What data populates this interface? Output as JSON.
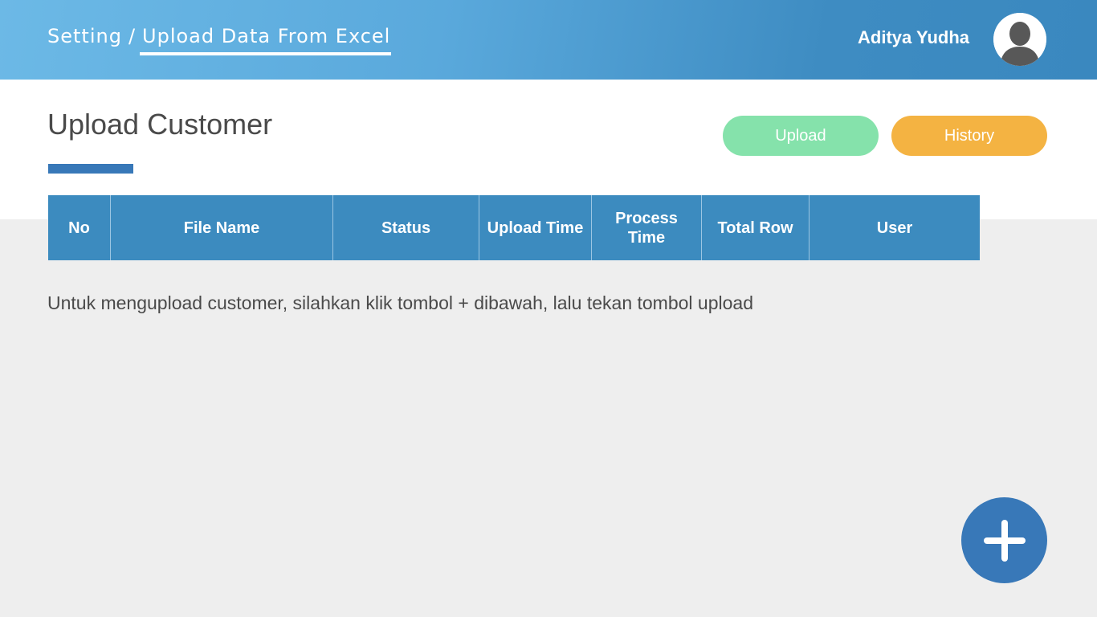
{
  "header": {
    "breadcrumb": {
      "parent": "Setting",
      "separator": "/",
      "current": "Upload Data From Excel"
    },
    "user": {
      "name": "Aditya Yudha",
      "avatar_icon": "user-avatar-icon"
    }
  },
  "main": {
    "title": "Upload Customer",
    "buttons": {
      "upload_label": "Upload",
      "history_label": "History"
    },
    "table": {
      "columns": [
        {
          "label": "No"
        },
        {
          "label": "File Name"
        },
        {
          "label": "Status"
        },
        {
          "label": "Upload Time"
        },
        {
          "label": "Process Time"
        },
        {
          "label": "Total Row"
        },
        {
          "label": "User"
        }
      ],
      "rows": []
    },
    "hint": "Untuk mengupload customer, silahkan klik tombol + dibawah, lalu tekan tombol upload",
    "fab_icon": "plus-icon"
  },
  "colors": {
    "header_gradient_start": "#6cb9e6",
    "header_gradient_end": "#3a88bf",
    "accent_blue": "#3878b8",
    "table_header": "#3c8bbf",
    "upload_button": "#85e2ab",
    "history_button": "#f4b342",
    "background": "#eeeeee"
  }
}
